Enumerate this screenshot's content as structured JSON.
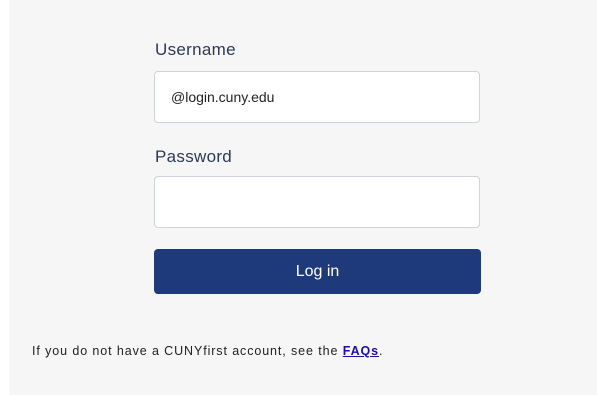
{
  "login_form": {
    "username_label": "Username",
    "username_value": "@login.cuny.edu",
    "password_label": "Password",
    "password_value": "",
    "submit_label": "Log in"
  },
  "help": {
    "text_before": "If you do not have a CUNYfirst account, see the ",
    "link_text": "FAQs",
    "text_after": "."
  },
  "colors": {
    "button_bg": "#1e3a7b",
    "panel_bg": "#f6f6f7",
    "link": "#1a0dab"
  }
}
